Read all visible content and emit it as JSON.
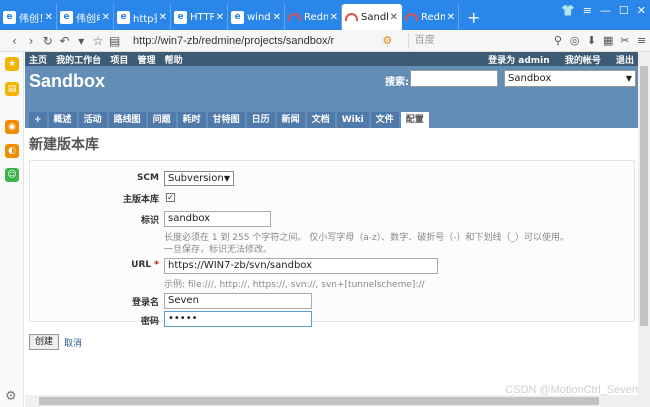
{
  "browser": {
    "tabs": [
      {
        "label": "伟创！",
        "icon": "ie-icon"
      },
      {
        "label": "伟创电",
        "icon": "ie-icon"
      },
      {
        "label": "http鉴",
        "icon": "ie-icon"
      },
      {
        "label": "HTTP",
        "icon": "ie-icon"
      },
      {
        "label": "windo",
        "icon": "ie-icon"
      },
      {
        "label": "Redm",
        "icon": "redmine-icon"
      },
      {
        "label": "Sandl",
        "icon": "redmine-icon",
        "active": true
      },
      {
        "label": "Redm",
        "icon": "redmine-icon"
      }
    ],
    "new_tab": "+",
    "url": "http://win7-zb/redmine/projects/sandbox/r",
    "search_engine_placeholder": "百度"
  },
  "topmenu": {
    "left": [
      "主页",
      "我的工作台",
      "项目",
      "管理",
      "帮助"
    ],
    "logged_in_as": "登录为 admin",
    "my_account": "我的帐号",
    "logout": "退出"
  },
  "header": {
    "project_title": "Sandbox",
    "search_label": "搜索:",
    "project_jump": "Sandbox"
  },
  "main_menu": [
    "+",
    "概述",
    "活动",
    "路线图",
    "问题",
    "耗时",
    "甘特图",
    "日历",
    "新闻",
    "文档",
    "Wiki",
    "文件",
    "配置"
  ],
  "main_menu_selected": "配置",
  "content": {
    "title": "新建版本库",
    "form": {
      "scm_label": "SCM",
      "scm_value": "Subversion",
      "main_repo_label": "主版本库",
      "main_repo_checked": true,
      "identifier_label": "标识",
      "identifier_value": "sandbox",
      "identifier_info_1": "长度必须在 1 到 255 个字符之间。 仅小写字母（a-z）、数字、破折号（-）和下划线（_）可以使用。",
      "identifier_info_2": "一旦保存，标识无法修改。",
      "url_label": "URL",
      "required_mark": "*",
      "url_value": "https://WIN7-zb/svn/sandbox",
      "url_info": "示例: file:///, http://, https://, svn://, svn+[tunnelscheme]://",
      "login_label": "登录名",
      "login_value": "Seven",
      "password_label": "密码",
      "password_value": "•••••"
    },
    "create_button": "创建",
    "cancel_link": "取消"
  },
  "watermark": "CSDN @MotionCtrl_Seven",
  "colors": {
    "browser_tabbar": "#2b86ea",
    "redmine_topmenu": "#3e5b76",
    "redmine_header": "#628db6",
    "required": "#bb0000"
  }
}
